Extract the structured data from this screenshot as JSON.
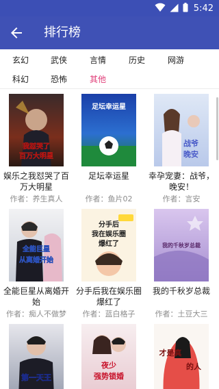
{
  "status_bar": {
    "time": "5:42",
    "icons": [
      "wifi-icon",
      "signal-icon",
      "battery-icon"
    ]
  },
  "app_bar": {
    "title": "排行榜",
    "back_icon": "arrow-back-icon"
  },
  "categories": [
    {
      "label": "玄幻",
      "active": false
    },
    {
      "label": "武侠",
      "active": false
    },
    {
      "label": "言情",
      "active": false
    },
    {
      "label": "历史",
      "active": false
    },
    {
      "label": "网游",
      "active": false
    },
    {
      "label": "科幻",
      "active": false
    },
    {
      "label": "恐怖",
      "active": false
    },
    {
      "label": "其他",
      "active": true
    }
  ],
  "books": [
    {
      "title": "娱乐之我怼哭了百万大明星",
      "author": "作者：养生真人",
      "cover_text": [
        "我怼哭了",
        "百万大明星"
      ]
    },
    {
      "title": "足坛幸运星",
      "author": "作者：鱼片02",
      "cover_text": [
        "足坛幸运星"
      ]
    },
    {
      "title": "幸孕宠妻：战爷，晚安！",
      "author": "作者：言安",
      "cover_text": [
        "战爷",
        "晚安"
      ]
    },
    {
      "title": "全能巨星从离婚开始",
      "author": "作者：痴人不做梦",
      "cover_text": [
        "全能巨星",
        "从离婚开始"
      ]
    },
    {
      "title": "分手后我在娱乐圈爆红了",
      "author": "作者：蓝白格子",
      "cover_text": [
        "分手后",
        "我在娱乐圈",
        "爆红了"
      ]
    },
    {
      "title": "我的千秋岁总裁",
      "author": "作者：土豆大三",
      "cover_text": [
        "我的千秋岁总裁"
      ]
    },
    {
      "title": "",
      "author": "",
      "cover_text": [
        "第一天王"
      ]
    },
    {
      "title": "",
      "author": "",
      "cover_text": [
        "夜少",
        "强势锁婚"
      ]
    },
    {
      "title": "",
      "author": "",
      "cover_text": [
        "才是真",
        "的人"
      ]
    }
  ],
  "colors": {
    "primary": "#3f51b5",
    "status_bar": "#3c4fb5",
    "accent_tab": "#e0407a",
    "author_gray": "#8c8c8c"
  }
}
